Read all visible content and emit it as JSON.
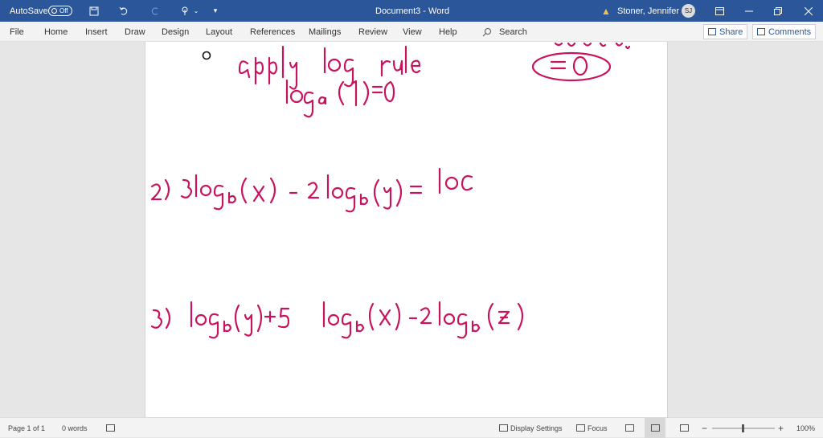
{
  "titlebar": {
    "autosave_label": "AutoSave",
    "autosave_state": "Off",
    "doc_title": "Document3  -  Word",
    "user_name": "Stoner, Jennifer L",
    "user_initials": "SJ"
  },
  "ribbon": {
    "tabs": [
      "File",
      "Home",
      "Insert",
      "Draw",
      "Design",
      "Layout",
      "References",
      "Mailings",
      "Review",
      "View",
      "Help"
    ],
    "search_label": "Search",
    "share_label": "Share",
    "comments_label": "Comments"
  },
  "document": {
    "ink_color": "#c8145f",
    "lines": [
      "=0",
      "apply log rule",
      "log_a (1) = 0",
      "2) 3log_b(x) - 2log_b(y) = log",
      "3) log_b(y) + 5 log_b(x) - 2log_b(z)"
    ]
  },
  "statusbar": {
    "page_info": "Page 1 of 1",
    "word_count": "0 words",
    "display_settings": "Display Settings",
    "focus": "Focus",
    "zoom": "100%"
  },
  "colors": {
    "title_bg": "#2b579a",
    "ribbon_bg": "#f3f3f3",
    "canvas_bg": "#e6e6e6"
  }
}
